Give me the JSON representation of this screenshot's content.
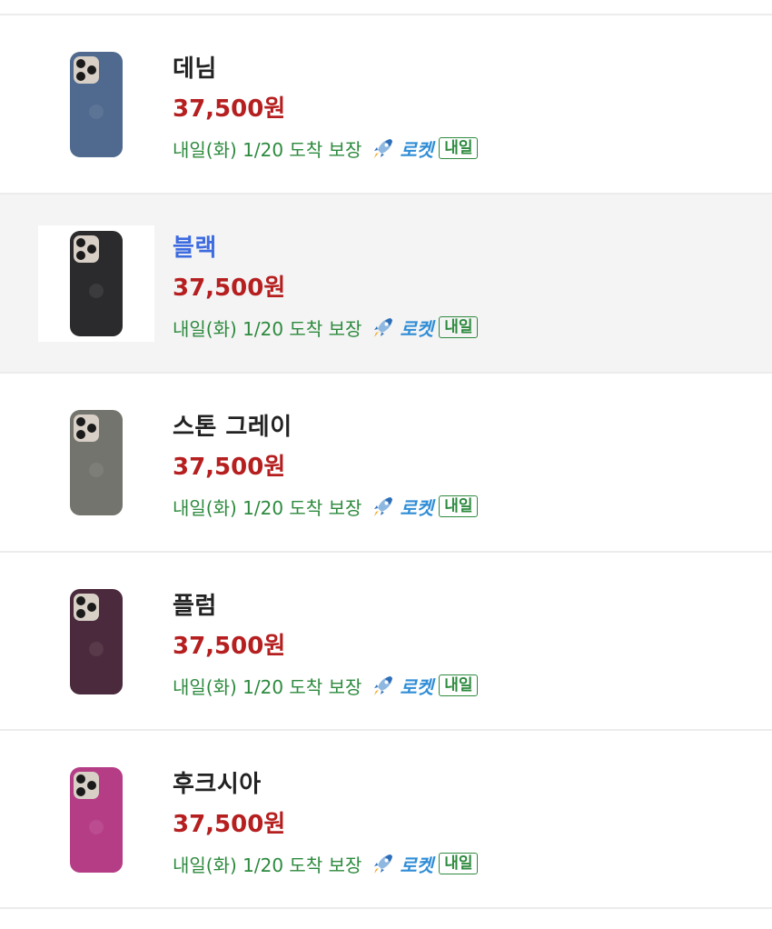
{
  "items": [
    {
      "name": "데님",
      "price": "37,500원",
      "delivery": "내일(화) 1/20 도착 보장",
      "rocket_label": "로켓",
      "badge": "내일",
      "case_color": "#4f6a8e",
      "selected": false
    },
    {
      "name": "블랙",
      "price": "37,500원",
      "delivery": "내일(화) 1/20 도착 보장",
      "rocket_label": "로켓",
      "badge": "내일",
      "case_color": "#2b2b2d",
      "selected": true
    },
    {
      "name": "스톤 그레이",
      "price": "37,500원",
      "delivery": "내일(화) 1/20 도착 보장",
      "rocket_label": "로켓",
      "badge": "내일",
      "case_color": "#74746e",
      "selected": false
    },
    {
      "name": "플럼",
      "price": "37,500원",
      "delivery": "내일(화) 1/20 도착 보장",
      "rocket_label": "로켓",
      "badge": "내일",
      "case_color": "#4a2a3c",
      "selected": false
    },
    {
      "name": "후크시아",
      "price": "37,500원",
      "delivery": "내일(화) 1/20 도착 보장",
      "rocket_label": "로켓",
      "badge": "내일",
      "case_color": "#b53d86",
      "selected": false
    }
  ],
  "icons": {
    "thumbnail": "phone-case-thumbnail",
    "rocket": "rocket-icon"
  },
  "colors": {
    "price": "#b61f1f",
    "delivery": "#2d8a3e",
    "rocket": "#2f8dd6",
    "selected_name": "#3d6be0"
  }
}
